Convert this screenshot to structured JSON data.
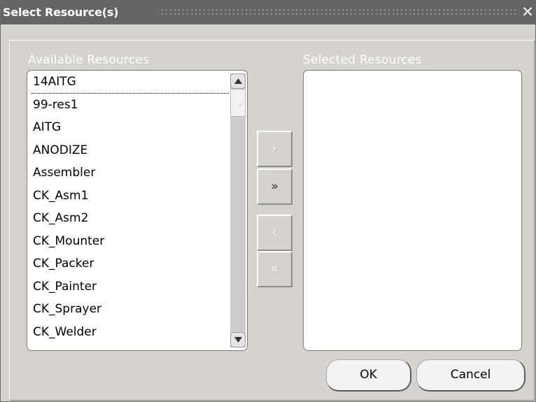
{
  "dialog": {
    "title": "Select Resource(s)",
    "close_glyph": "✕"
  },
  "available": {
    "label": "Available Resources",
    "items": [
      "14AITG",
      "99-res1",
      "AITG",
      "ANODIZE",
      "Assembler",
      "CK_Asm1",
      "CK_Asm2",
      "CK_Mounter",
      "CK_Packer",
      "CK_Painter",
      "CK_Sprayer",
      "CK_Welder"
    ],
    "focused_index": 0
  },
  "selected": {
    "label": "Selected Resources",
    "items": []
  },
  "shuttle": {
    "move_glyph": "›",
    "move_all_glyph": "»",
    "remove_glyph": "‹",
    "remove_all_glyph": "«"
  },
  "buttons": {
    "ok_label": "OK",
    "cancel_label": "Cancel"
  },
  "colors": {
    "titlebar": "#656565",
    "panel": "#d6d3ce",
    "label_text": "#ffffff"
  },
  "icons": {
    "close": "close-icon",
    "scroll_up": "arrow-up-icon",
    "scroll_down": "arrow-down-icon",
    "move": "chevron-right-icon",
    "move_all": "double-chevron-right-icon",
    "remove": "chevron-left-icon",
    "remove_all": "double-chevron-left-icon"
  }
}
